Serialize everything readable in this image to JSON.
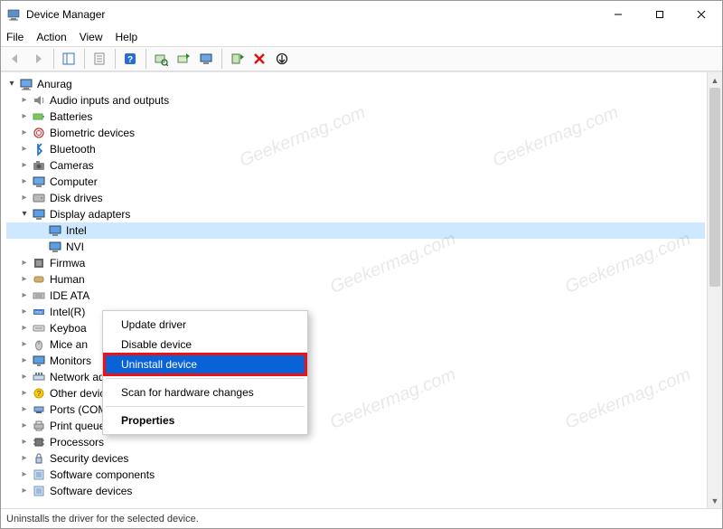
{
  "window": {
    "title": "Device Manager"
  },
  "menubar": {
    "file": "File",
    "action": "Action",
    "view": "View",
    "help": "Help"
  },
  "tree": {
    "root": "Anurag",
    "nodes": [
      {
        "label": "Audio inputs and outputs",
        "icon": "audio"
      },
      {
        "label": "Batteries",
        "icon": "battery"
      },
      {
        "label": "Biometric devices",
        "icon": "biometric"
      },
      {
        "label": "Bluetooth",
        "icon": "bluetooth"
      },
      {
        "label": "Cameras",
        "icon": "camera"
      },
      {
        "label": "Computer",
        "icon": "computer"
      },
      {
        "label": "Disk drives",
        "icon": "disk"
      }
    ],
    "display_adapters": {
      "label": "Display adapters",
      "children": [
        {
          "label": "Intel",
          "selected": true
        },
        {
          "label": "NVI"
        }
      ]
    },
    "nodes_after": [
      {
        "label": "Firmwa",
        "icon": "firmware"
      },
      {
        "label": "Human",
        "icon": "hid"
      },
      {
        "label": "IDE ATA",
        "icon": "ide"
      },
      {
        "label": "Intel(R)",
        "icon": "intel"
      },
      {
        "label": "Keyboa",
        "icon": "keyboard"
      },
      {
        "label": "Mice an",
        "icon": "mouse"
      },
      {
        "label": "Monitors",
        "icon": "monitor"
      },
      {
        "label": "Network adapters",
        "icon": "network"
      },
      {
        "label": "Other devices",
        "icon": "other"
      },
      {
        "label": "Ports (COM & LPT)",
        "icon": "ports"
      },
      {
        "label": "Print queues",
        "icon": "printer"
      },
      {
        "label": "Processors",
        "icon": "cpu"
      },
      {
        "label": "Security devices",
        "icon": "security"
      },
      {
        "label": "Software components",
        "icon": "software"
      },
      {
        "label": "Software devices",
        "icon": "software"
      }
    ]
  },
  "context_menu": {
    "update": "Update driver",
    "disable": "Disable device",
    "uninstall": "Uninstall device",
    "scan": "Scan for hardware changes",
    "properties": "Properties"
  },
  "statusbar": {
    "text": "Uninstalls the driver for the selected device."
  },
  "watermark": "Geekermag.com"
}
